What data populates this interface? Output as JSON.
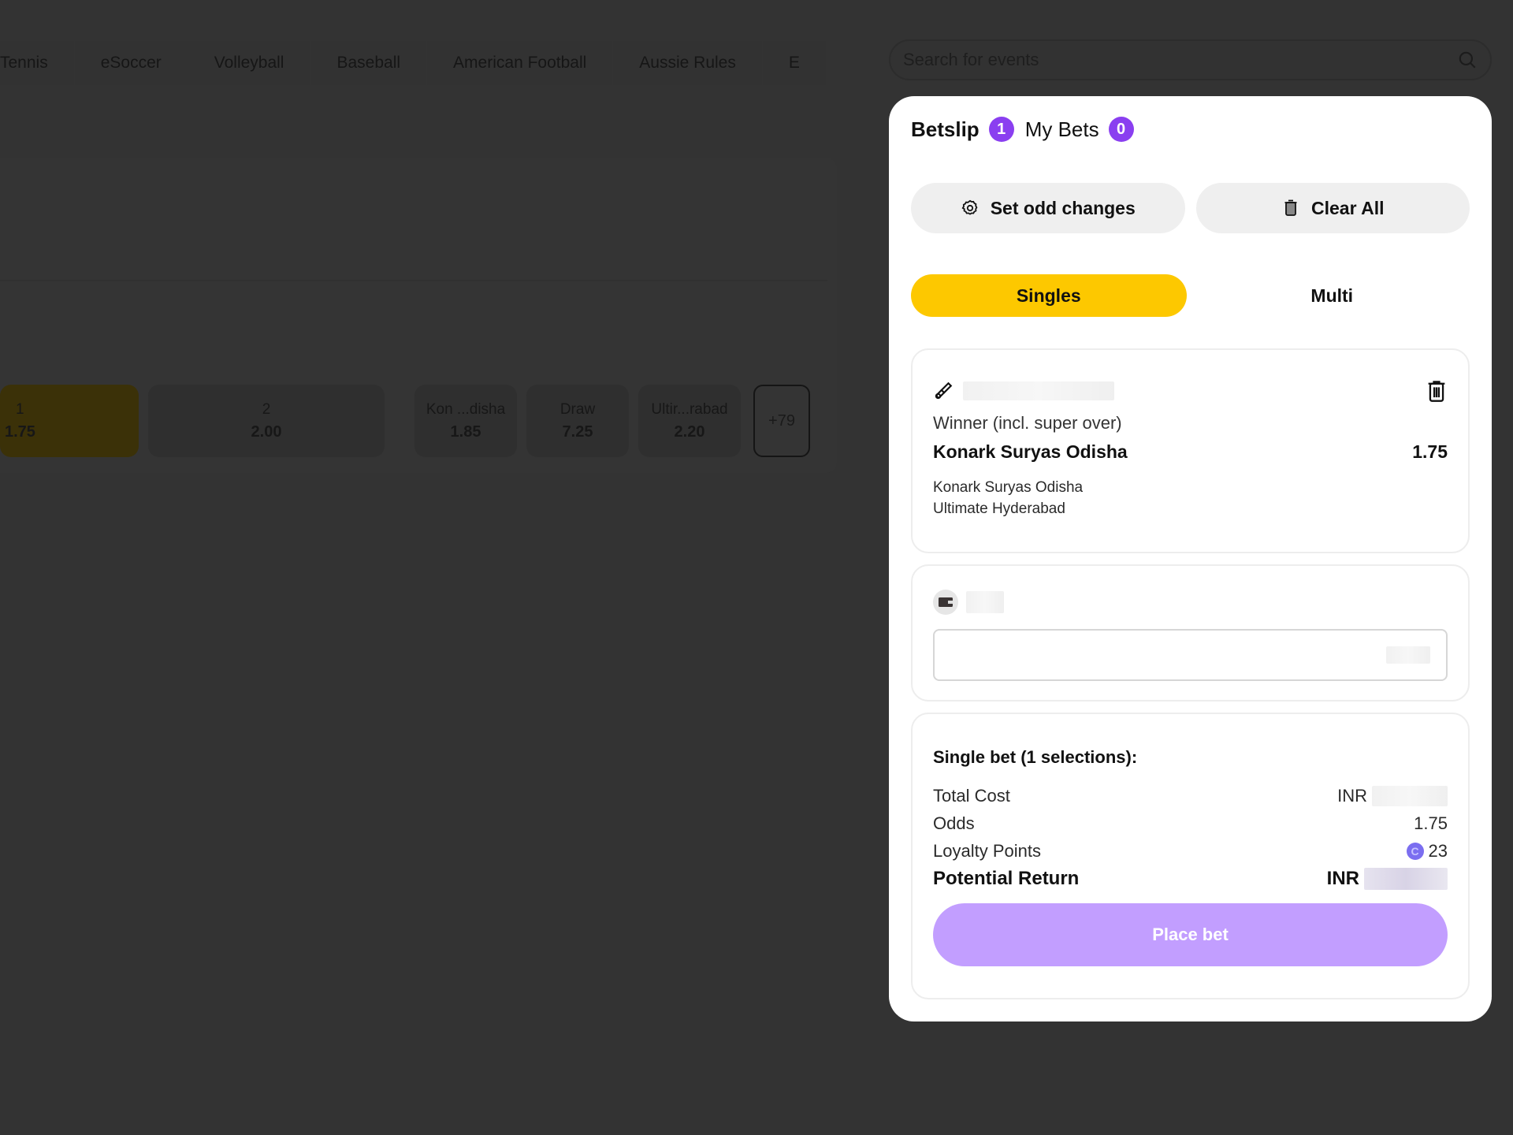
{
  "sports_nav": {
    "items": [
      "Tennis",
      "eSoccer",
      "Volleyball",
      "Baseball",
      "American Football",
      "Aussie Rules",
      "E"
    ]
  },
  "search": {
    "placeholder": "Search for events",
    "icon": "search-icon"
  },
  "match": {
    "odds": [
      {
        "label": "1",
        "value": "1.75",
        "selected": true
      },
      {
        "label": "2",
        "value": "2.00",
        "selected": false
      },
      {
        "label": "Kon ...disha",
        "value": "1.85",
        "selected": false
      },
      {
        "label": "Draw",
        "value": "7.25",
        "selected": false
      },
      {
        "label": "Ultir...rabad",
        "value": "2.20",
        "selected": false
      }
    ],
    "more_markets": "+79"
  },
  "betslip": {
    "tabs": [
      {
        "label": "Betslip",
        "count": "1",
        "active": true
      },
      {
        "label": "My Bets",
        "count": "0",
        "active": false
      }
    ],
    "actions": {
      "set_odd_changes": "Set odd changes",
      "clear_all": "Clear All"
    },
    "modes": [
      {
        "label": "Singles",
        "active": true
      },
      {
        "label": "Multi",
        "active": false
      }
    ],
    "selection": {
      "sport_icon": "cricket-icon",
      "market": "Winner (incl. super over)",
      "pick": "Konark Suryas Odisha",
      "odds": "1.75",
      "team_home": "Konark Suryas Odisha",
      "team_away": "Ultimate Hyderabad"
    },
    "stake": {
      "wallet_icon": "wallet-icon",
      "value": ""
    },
    "summary": {
      "title": "Single bet (1 selections):",
      "total_cost_label": "Total Cost",
      "total_cost_currency": "INR",
      "odds_label": "Odds",
      "odds_value": "1.75",
      "loyalty_label": "Loyalty Points",
      "loyalty_value": "23",
      "potential_return_label": "Potential Return",
      "potential_return_currency": "INR"
    },
    "place_bet_label": "Place bet"
  },
  "colors": {
    "accent_purple": "#8a3ff0",
    "selected_yellow": "#fdc800",
    "place_bet_disabled": "#c29eff",
    "overlay": "#333333"
  }
}
